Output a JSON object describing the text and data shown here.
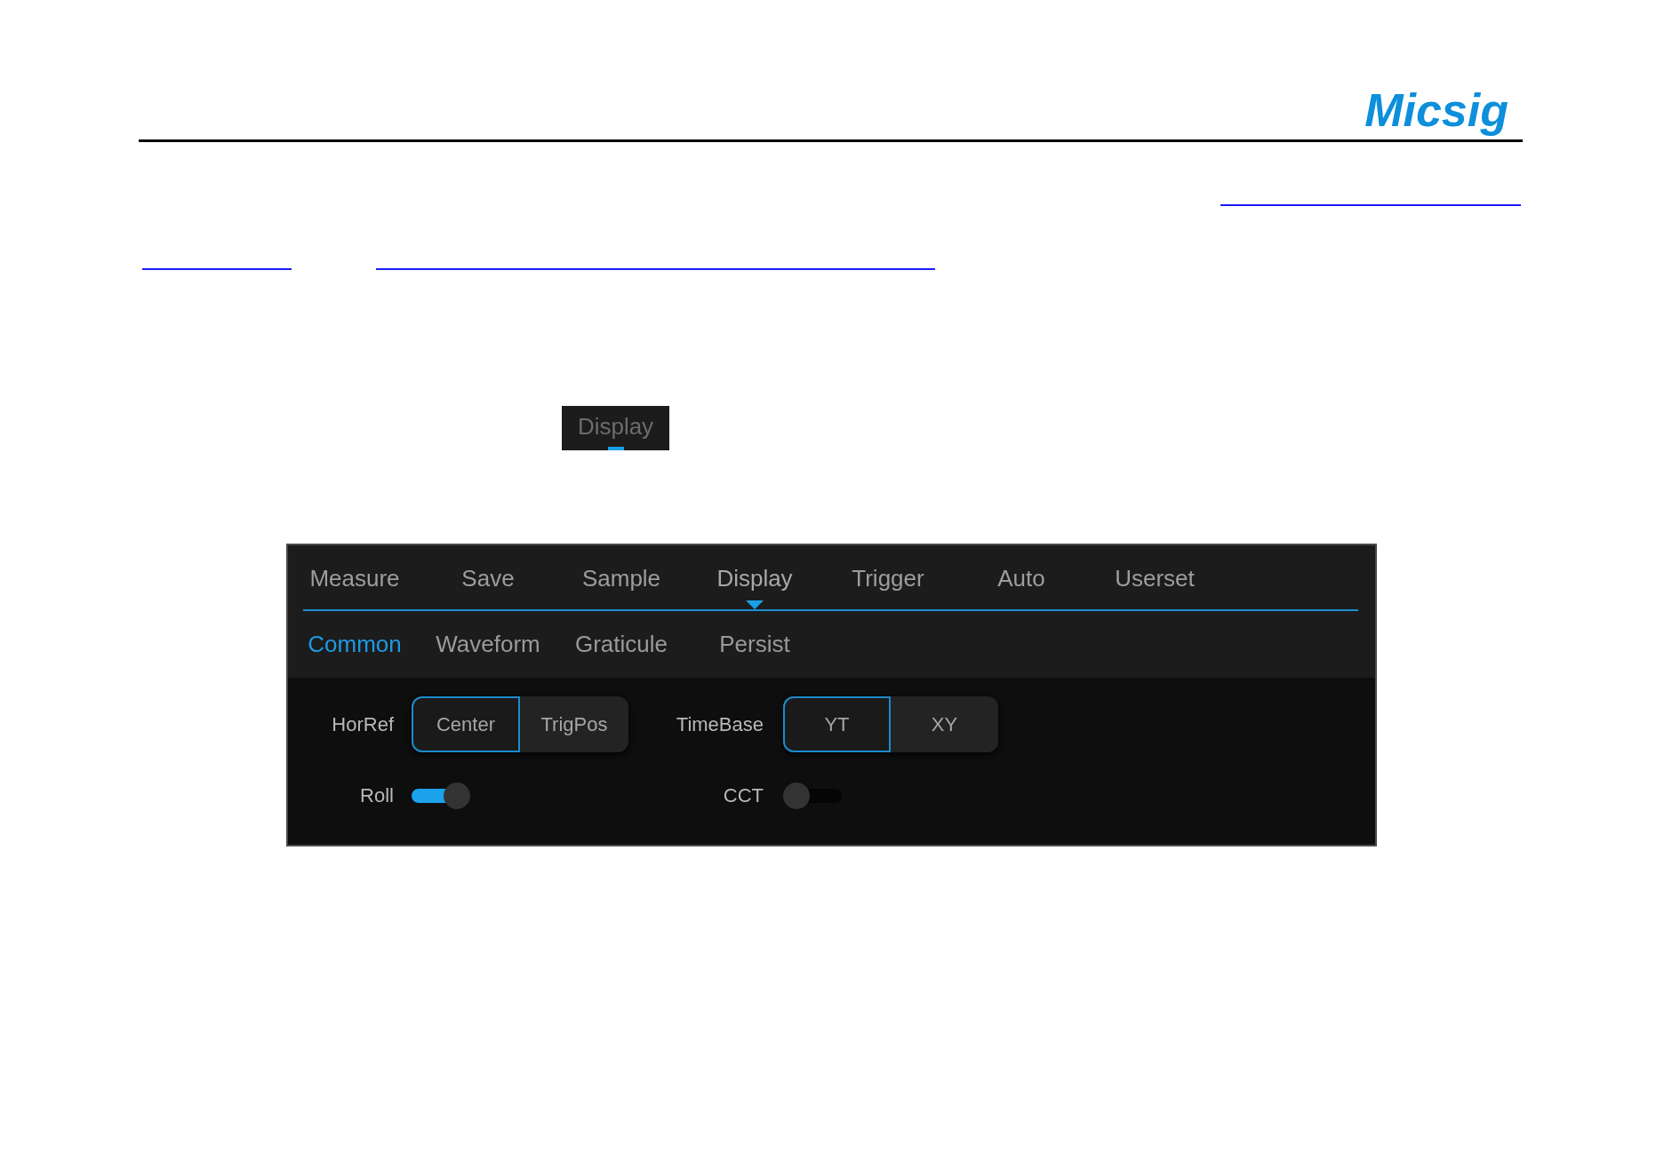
{
  "header": {
    "logo": "Micsig"
  },
  "menu_button": {
    "label": "Display"
  },
  "panel": {
    "tabs": [
      {
        "label": "Measure",
        "selected": false
      },
      {
        "label": "Save",
        "selected": false
      },
      {
        "label": "Sample",
        "selected": false
      },
      {
        "label": "Display",
        "selected": true
      },
      {
        "label": "Trigger",
        "selected": false
      },
      {
        "label": "Auto",
        "selected": false
      },
      {
        "label": "Userset",
        "selected": false
      }
    ],
    "subtabs": [
      {
        "label": "Common",
        "selected": true
      },
      {
        "label": "Waveform",
        "selected": false
      },
      {
        "label": "Graticule",
        "selected": false
      },
      {
        "label": "Persist",
        "selected": false
      }
    ],
    "rows": [
      [
        {
          "kind": "segmented",
          "label": "HorRef",
          "options": [
            {
              "label": "Center",
              "selected": true
            },
            {
              "label": "TrigPos",
              "selected": false
            }
          ]
        },
        {
          "kind": "segmented",
          "label": "TimeBase",
          "options": [
            {
              "label": "YT",
              "selected": true
            },
            {
              "label": "XY",
              "selected": false
            }
          ]
        }
      ],
      [
        {
          "kind": "toggle",
          "label": "Roll",
          "on": true
        },
        {
          "kind": "toggle",
          "label": "CCT",
          "on": false
        }
      ]
    ]
  }
}
